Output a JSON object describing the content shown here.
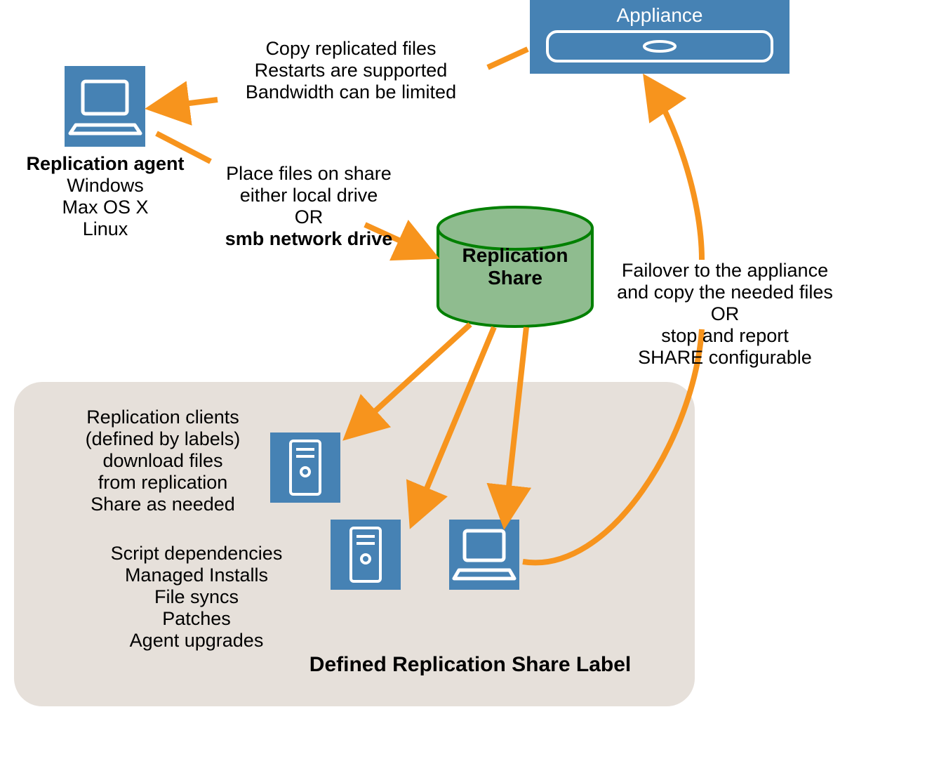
{
  "colors": {
    "blue": "#4682b4",
    "orange": "#f7941d",
    "green_stroke": "#008000",
    "green_fill": "#8fbc8f",
    "box_bg": "#e6e0da"
  },
  "appliance": {
    "title": "Appliance"
  },
  "agent": {
    "title": "Replication agent",
    "line2": "Windows",
    "line3": "Max OS X",
    "line4": "Linux"
  },
  "copy_block": {
    "line1": "Copy replicated files",
    "line2": "Restarts are supported",
    "line3": "Bandwidth can be limited"
  },
  "place_block": {
    "line1": "Place files on share",
    "line2": "either local drive",
    "line3": "OR",
    "line4": "smb network drive"
  },
  "share": {
    "line1": "Replication",
    "line2": "Share"
  },
  "failover_block": {
    "line1": "Failover to the appliance",
    "line2": "and copy the needed files",
    "line3": "OR",
    "line4": "stop and report",
    "line5": "SHARE configurable"
  },
  "clients_block": {
    "line1": "Replication clients",
    "line2": "(defined by labels)",
    "line3": "download files",
    "line4": "from replication",
    "line5": "Share as needed"
  },
  "script_block": {
    "line1": "Script dependencies",
    "line2": "Managed Installs",
    "line3": "File syncs",
    "line4": "Patches",
    "line5": "Agent upgrades"
  },
  "footer": {
    "title": "Defined Replication Share Label"
  }
}
